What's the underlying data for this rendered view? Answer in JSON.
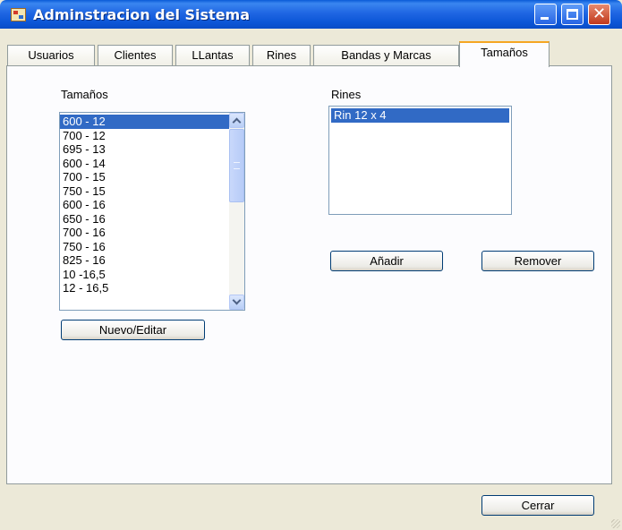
{
  "window": {
    "title": "Adminstracion del Sistema",
    "app_icon": "app-icon"
  },
  "title_buttons": {
    "minimize": "minimize-icon",
    "maximize": "maximize-icon",
    "close": "close-icon",
    "close_glyph": "✕"
  },
  "tabs": [
    {
      "label": "Usuarios",
      "active": false
    },
    {
      "label": "Clientes",
      "active": false
    },
    {
      "label": "LLantas",
      "active": false
    },
    {
      "label": "Rines",
      "active": false
    },
    {
      "label": "Bandas y Marcas",
      "active": false
    },
    {
      "label": "Tamaños",
      "active": true
    }
  ],
  "tamanos": {
    "label": "Tamaños",
    "items": [
      "600 - 12",
      "700 - 12",
      "695 - 13",
      "600 - 14",
      "700 - 15",
      "750 - 15",
      "600 - 16",
      "650 - 16",
      "700 - 16",
      "750 - 16",
      "825 - 16",
      "10 -16,5",
      "12 - 16,5"
    ],
    "selected_index": 0,
    "button_label": "Nuevo/Editar"
  },
  "rines": {
    "label": "Rines",
    "items": [
      "Rin 12 x 4"
    ],
    "selected_index": 0
  },
  "actions": {
    "add_label": "Añadir",
    "remove_label": "Remover"
  },
  "footer": {
    "close_label": "Cerrar"
  }
}
